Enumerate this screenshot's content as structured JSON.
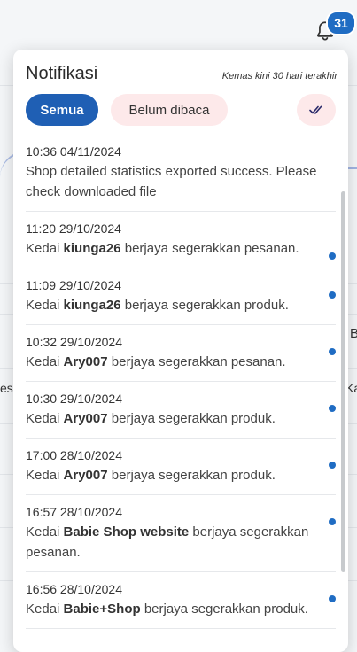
{
  "header": {
    "notification_count": "31"
  },
  "background": {
    "fragments": [
      "B",
      "esa",
      "Ka"
    ]
  },
  "panel": {
    "title": "Notifikasi",
    "subtitle": "Kemas kini 30 hari terakhir",
    "tabs": [
      {
        "label": "Semua",
        "active": true
      },
      {
        "label": "Belum dibaca",
        "active": false
      }
    ]
  },
  "notifications": [
    {
      "time": "10:36 04/11/2024",
      "pre": "Shop detailed statistics exported success. Please check downloaded file",
      "bold": "",
      "post": "",
      "unread": false
    },
    {
      "time": "11:20 29/10/2024",
      "pre": "Kedai ",
      "bold": "kiunga26",
      "post": " berjaya segerakkan pesanan.",
      "unread": true
    },
    {
      "time": "11:09 29/10/2024",
      "pre": "Kedai ",
      "bold": "kiunga26",
      "post": " berjaya segerakkan produk.",
      "unread": true
    },
    {
      "time": "10:32 29/10/2024",
      "pre": "Kedai ",
      "bold": "Ary007",
      "post": " berjaya segerakkan pesanan.",
      "unread": true
    },
    {
      "time": "10:30 29/10/2024",
      "pre": "Kedai ",
      "bold": "Ary007",
      "post": " berjaya segerakkan produk.",
      "unread": true
    },
    {
      "time": "17:00 28/10/2024",
      "pre": "Kedai ",
      "bold": "Ary007",
      "post": " berjaya segerakkan produk.",
      "unread": true
    },
    {
      "time": "16:57 28/10/2024",
      "pre": "Kedai ",
      "bold": "Babie Shop website",
      "post": " berjaya segerakkan pesanan.",
      "unread": true
    },
    {
      "time": "16:56 28/10/2024",
      "pre": "Kedai ",
      "bold": "Babie+Shop",
      "post": " berjaya segerakkan produk.",
      "unread": true
    }
  ],
  "colors": {
    "accent": "#1f5fb4",
    "badge": "#1f6cc3",
    "unread_dot": "#1f6cc3",
    "pill_bg": "#fde9ea"
  }
}
